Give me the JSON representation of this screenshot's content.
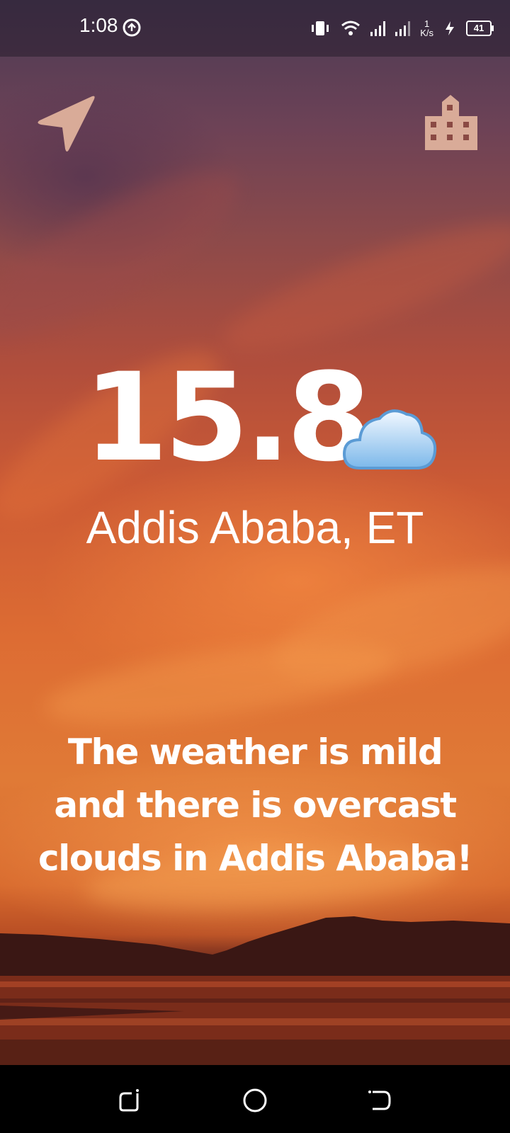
{
  "status_bar": {
    "time": "1:08",
    "network_speed_value": "1",
    "network_speed_unit": "K/s",
    "battery_level": "41"
  },
  "weather": {
    "temperature": "15.8",
    "condition_icon": "cloud-icon",
    "city": "Addis Ababa, ET",
    "message": "The weather is mild and there is overcast clouds in Addis Ababa!"
  },
  "toolbar": {
    "left_icon": "navigation-arrow-icon",
    "right_icon": "city-building-icon"
  },
  "colors": {
    "icon_tint": "#D9AB98",
    "text": "#FFFFFF"
  }
}
